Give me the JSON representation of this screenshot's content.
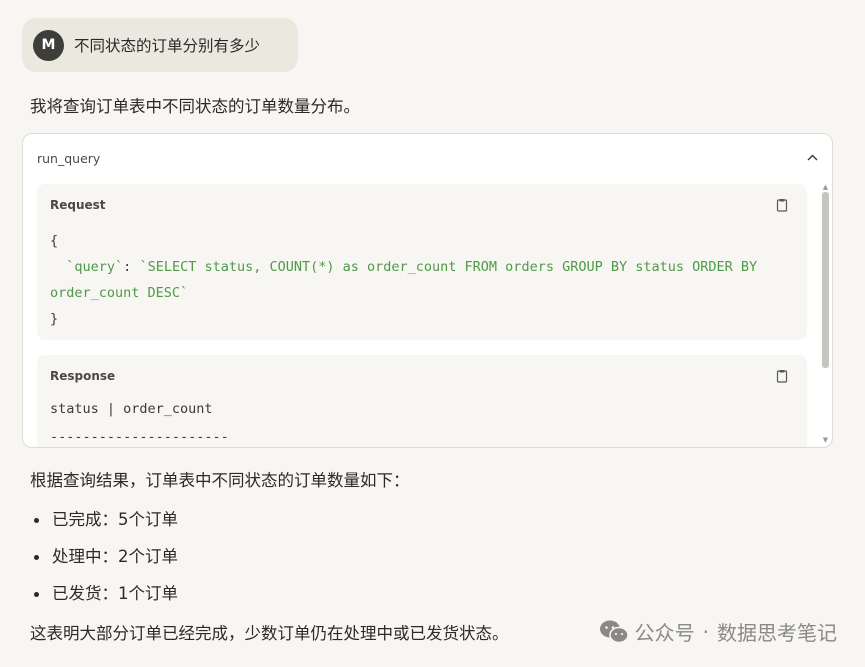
{
  "user_message": {
    "avatar_letter": "M",
    "text": "不同状态的订单分别有多少"
  },
  "assistant": {
    "intro": "我将查询订单表中不同状态的订单数量分布。",
    "tool_call": {
      "name": "run_query",
      "request": {
        "label": "Request",
        "open_brace": "{",
        "key": "  `query`",
        "colon": ": ",
        "value": "`SELECT status, COUNT(*) as order_count FROM orders GROUP BY status ORDER BY order_count DESC`",
        "close_brace": "}"
      },
      "response": {
        "label": "Response",
        "lines": [
          "status | order_count",
          "----------------------"
        ]
      }
    },
    "summary": "根据查询结果，订单表中不同状态的订单数量如下：",
    "results": [
      "已完成：5个订单",
      "处理中：2个订单",
      "已发货：1个订单"
    ],
    "conclusion": "这表明大部分订单已经完成，少数订单仍在处理中或已发货状态。"
  },
  "watermark": {
    "left": "公众号",
    "separator": "·",
    "right": "数据思考笔记"
  },
  "icons": {
    "collapse": "chevron-up-icon",
    "copy": "clipboard-icon",
    "watermark": "wechat-icon"
  },
  "colors": {
    "page_bg": "#f7f6f2",
    "bubble_bg": "#ebe8e0",
    "code_string": "#4f9a48",
    "avatar_bg": "#3d3d3a"
  }
}
